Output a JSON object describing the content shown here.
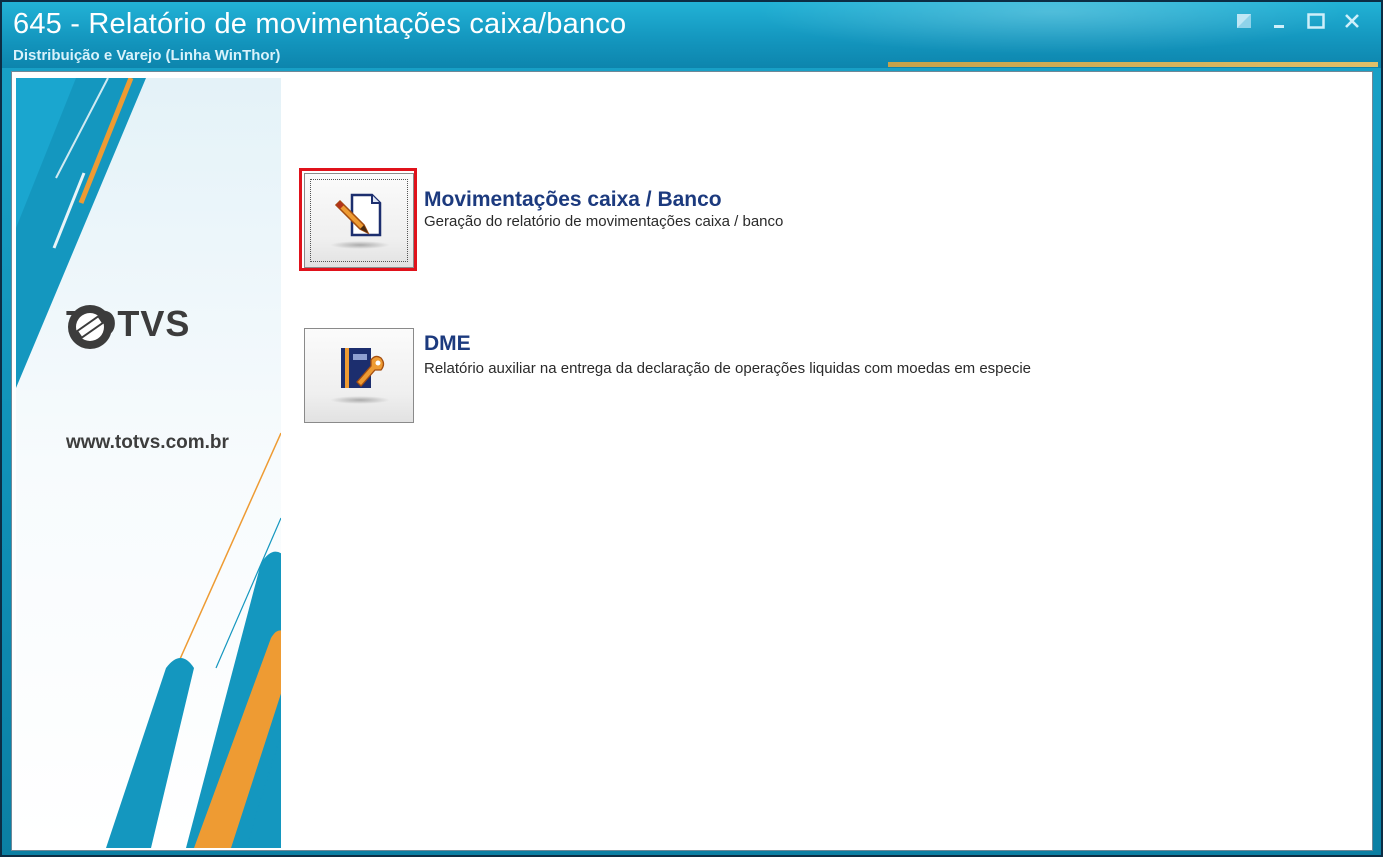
{
  "window": {
    "title": "645 - Relatório de movimentações caixa/banco",
    "subtitle": "Distribuição e Varejo (Linha WinThor)"
  },
  "banner": {
    "logo_text": "TOTVS",
    "website": "www.totvs.com.br",
    "colors": {
      "blue": "#1497bf",
      "orange": "#ee9b33"
    }
  },
  "items": [
    {
      "title": "Movimentações caixa / Banco",
      "description": "Geração do relatório de movimentações caixa / banco",
      "icon": "document-edit-icon",
      "highlighted": true
    },
    {
      "title": "DME",
      "description": "Relatório auxiliar na entrega da declaração de operações liquidas com moedas em especie",
      "icon": "book-tool-icon",
      "highlighted": false
    }
  ],
  "colors": {
    "title_bar": "#1497bf",
    "item_title": "#1c3a7e",
    "highlight": "#e0121b"
  }
}
